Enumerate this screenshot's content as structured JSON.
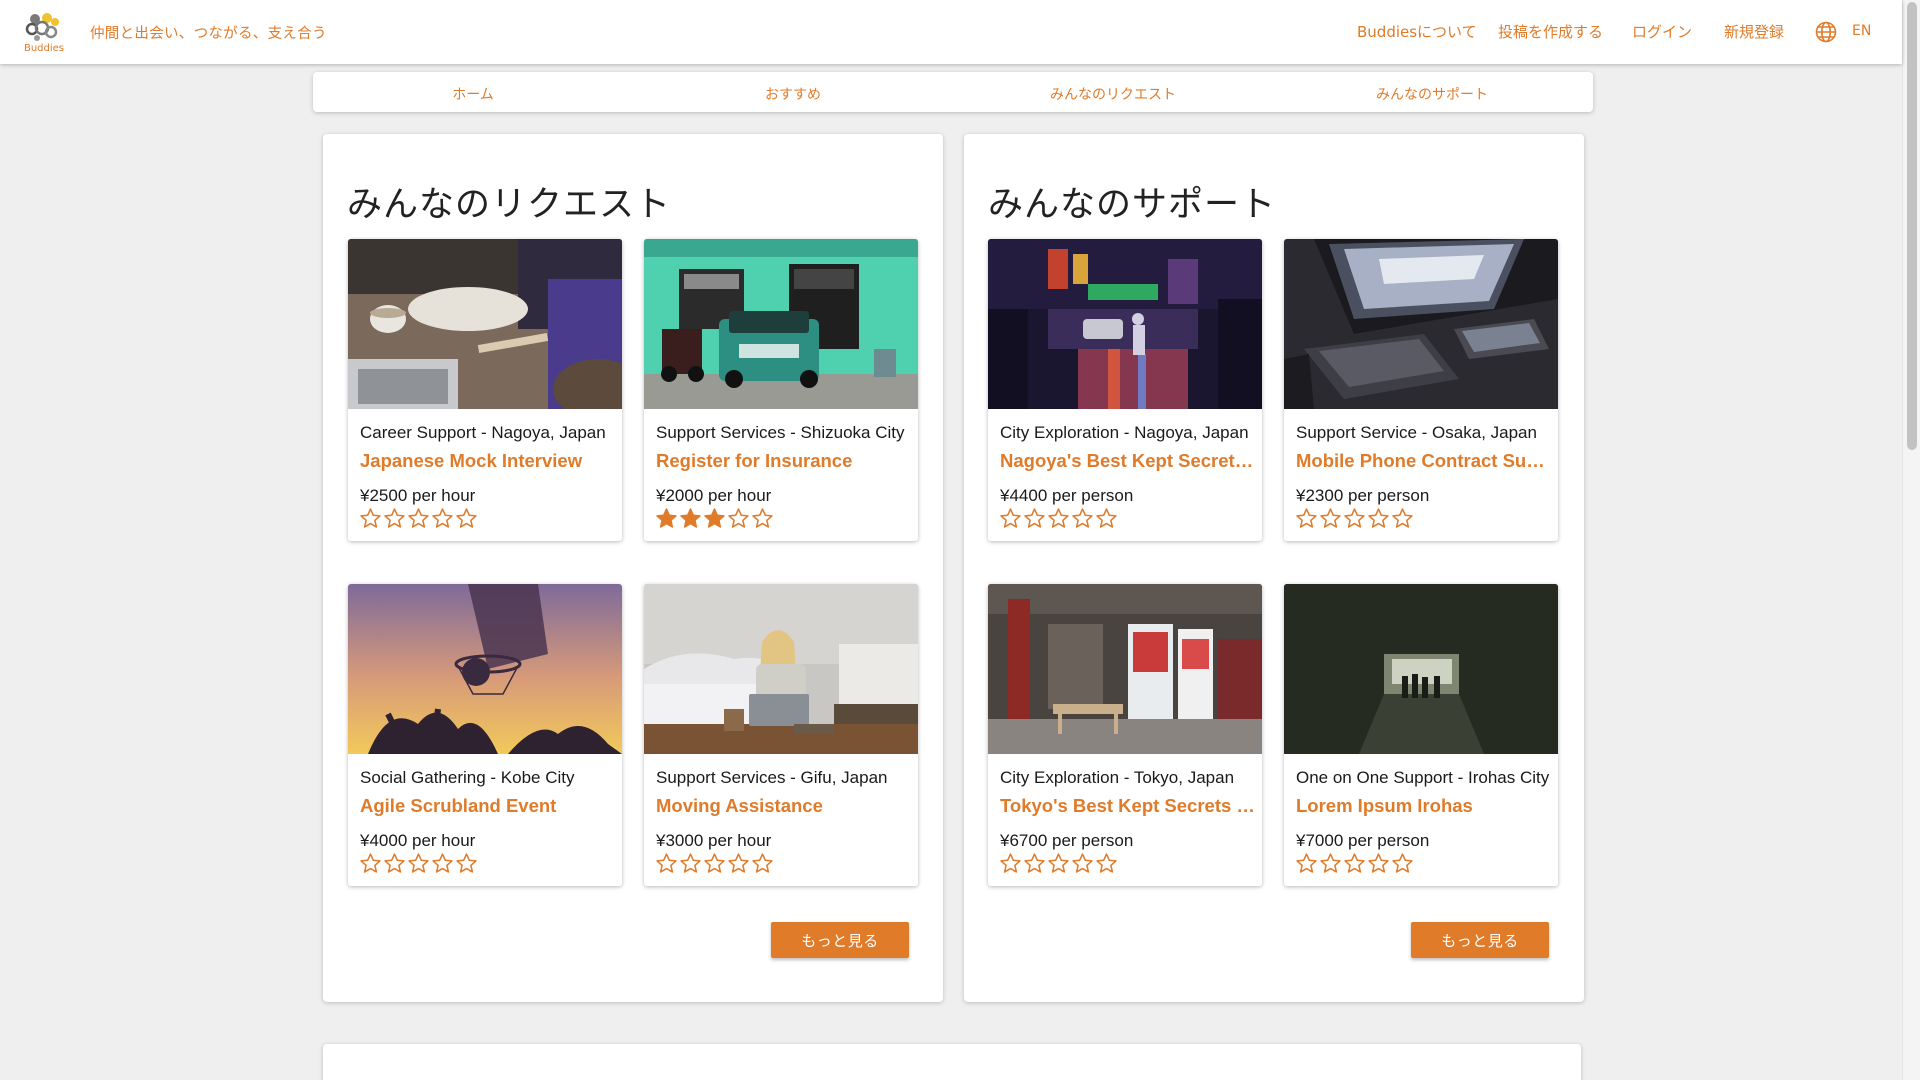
{
  "header": {
    "logo_text": "Buddies",
    "tagline": "仲間と出会い、つながる、支え合う",
    "nav": [
      "Buddiesについて",
      "投稿を作成する",
      "ログイン",
      "新規登録"
    ],
    "language": "EN"
  },
  "tabs": [
    "ホーム",
    "おすすめ",
    "みんなのリクエスト",
    "みんなのサポート"
  ],
  "requests": {
    "heading": "みんなのリクエスト",
    "more_label": "もっと見る",
    "cards": [
      {
        "category": "Career Support - Nagoya, Japan",
        "title": "Japanese Mock Interview",
        "price": "¥2500 per hour",
        "rating": 0,
        "image": "laptop-meeting-photo"
      },
      {
        "category": "Support Services - Shizuoka City",
        "title": "Register for Insurance",
        "price": "¥2000 per hour",
        "rating": 3,
        "image": "green-car-photo"
      },
      {
        "category": "Social Gathering - Kobe City",
        "title": "Agile Scrubland Event",
        "price": "¥4000 per hour",
        "rating": 0,
        "image": "basketball-hoop-photo"
      },
      {
        "category": "Support Services - Gifu, Japan",
        "title": "Moving Assistance",
        "price": "¥3000 per hour",
        "rating": 0,
        "image": "woman-with-laptop-photo"
      }
    ]
  },
  "supports": {
    "heading": "みんなのサポート",
    "more_label": "もっと見る",
    "cards": [
      {
        "category": "City Exploration - Nagoya, Japan",
        "title": "Nagoya's Best Kept Secrets Tour",
        "price": "¥4400 per person",
        "rating": 0,
        "image": "night-street-photo"
      },
      {
        "category": "Support Service - Osaka, Japan",
        "title": "Mobile Phone Contract Support",
        "price": "¥2300 per person",
        "rating": 0,
        "image": "devices-photo"
      },
      {
        "category": "City Exploration - Tokyo, Japan",
        "title": "Tokyo's Best Kept Secrets Tour",
        "price": "¥6700 per person",
        "rating": 0,
        "image": "shopfront-photo"
      },
      {
        "category": "One on One Support - Irohas City",
        "title": "Lorem Ipsum Irohas",
        "price": "¥7000 per person",
        "rating": 0,
        "image": "tunnel-photo"
      }
    ]
  },
  "colors": {
    "accent": "#e07b2a",
    "background": "#efefef"
  }
}
